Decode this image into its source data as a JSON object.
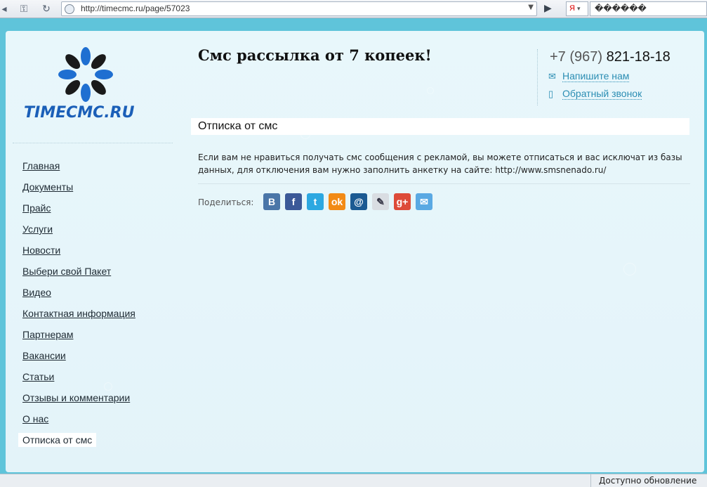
{
  "browser": {
    "url": "http://timecmc.ru/page/57023",
    "search_engine_label": "Я",
    "search_value": "������"
  },
  "site": {
    "logo_text": "TIMECMC.RU",
    "headline": "Смс рассылка от 7 копеек!",
    "phone_prefix": "+7 (967)",
    "phone_number": "821-18-18",
    "write_us": "Напишите нам",
    "callback": "Обратный звонок"
  },
  "nav": [
    {
      "label": "Главная"
    },
    {
      "label": "Документы"
    },
    {
      "label": "Прайс"
    },
    {
      "label": "Услуги"
    },
    {
      "label": "Новости"
    },
    {
      "label": "Выбери свой Пакет"
    },
    {
      "label": "Видео"
    },
    {
      "label": "Контактная информация"
    },
    {
      "label": "Партнерам"
    },
    {
      "label": "Вакансии"
    },
    {
      "label": "Статьи"
    },
    {
      "label": "Отзывы и комментарии"
    },
    {
      "label": "О нас"
    },
    {
      "label": "Отписка от смс",
      "active": true
    }
  ],
  "content": {
    "title": "Отписка от смс",
    "text": "Если вам не нравиться получать смс сообщения с рекламой, вы можете отписаться и вас исключат из базы данных, для отключения вам нужно заполнить анкетку на сайте: http://www.smsnenado.ru/",
    "share_label": "Поделиться:",
    "share_buttons": [
      {
        "name": "vkontakte-icon",
        "glyph": "B",
        "color": "#4a76a8"
      },
      {
        "name": "facebook-icon",
        "glyph": "f",
        "color": "#3b5998"
      },
      {
        "name": "twitter-icon",
        "glyph": "t",
        "color": "#2ca8e1"
      },
      {
        "name": "odnoklassniki-icon",
        "glyph": "ok",
        "color": "#f28a15"
      },
      {
        "name": "mailru-icon",
        "glyph": "@",
        "color": "#1b5a92"
      },
      {
        "name": "livejournal-icon",
        "glyph": "✎",
        "color": "#d9dde2"
      },
      {
        "name": "google-plus-icon",
        "glyph": "g+",
        "color": "#dd4b39"
      },
      {
        "name": "email-icon",
        "glyph": "✉",
        "color": "#5aa9e3"
      }
    ]
  },
  "statusbar": {
    "update_text": "Доступно обновление"
  },
  "colors": {
    "brand_blue": "#1b5fb8",
    "link_blue": "#2b8db3",
    "page_bg": "#e6f5fa",
    "outer_bg": "#5fc4da"
  }
}
